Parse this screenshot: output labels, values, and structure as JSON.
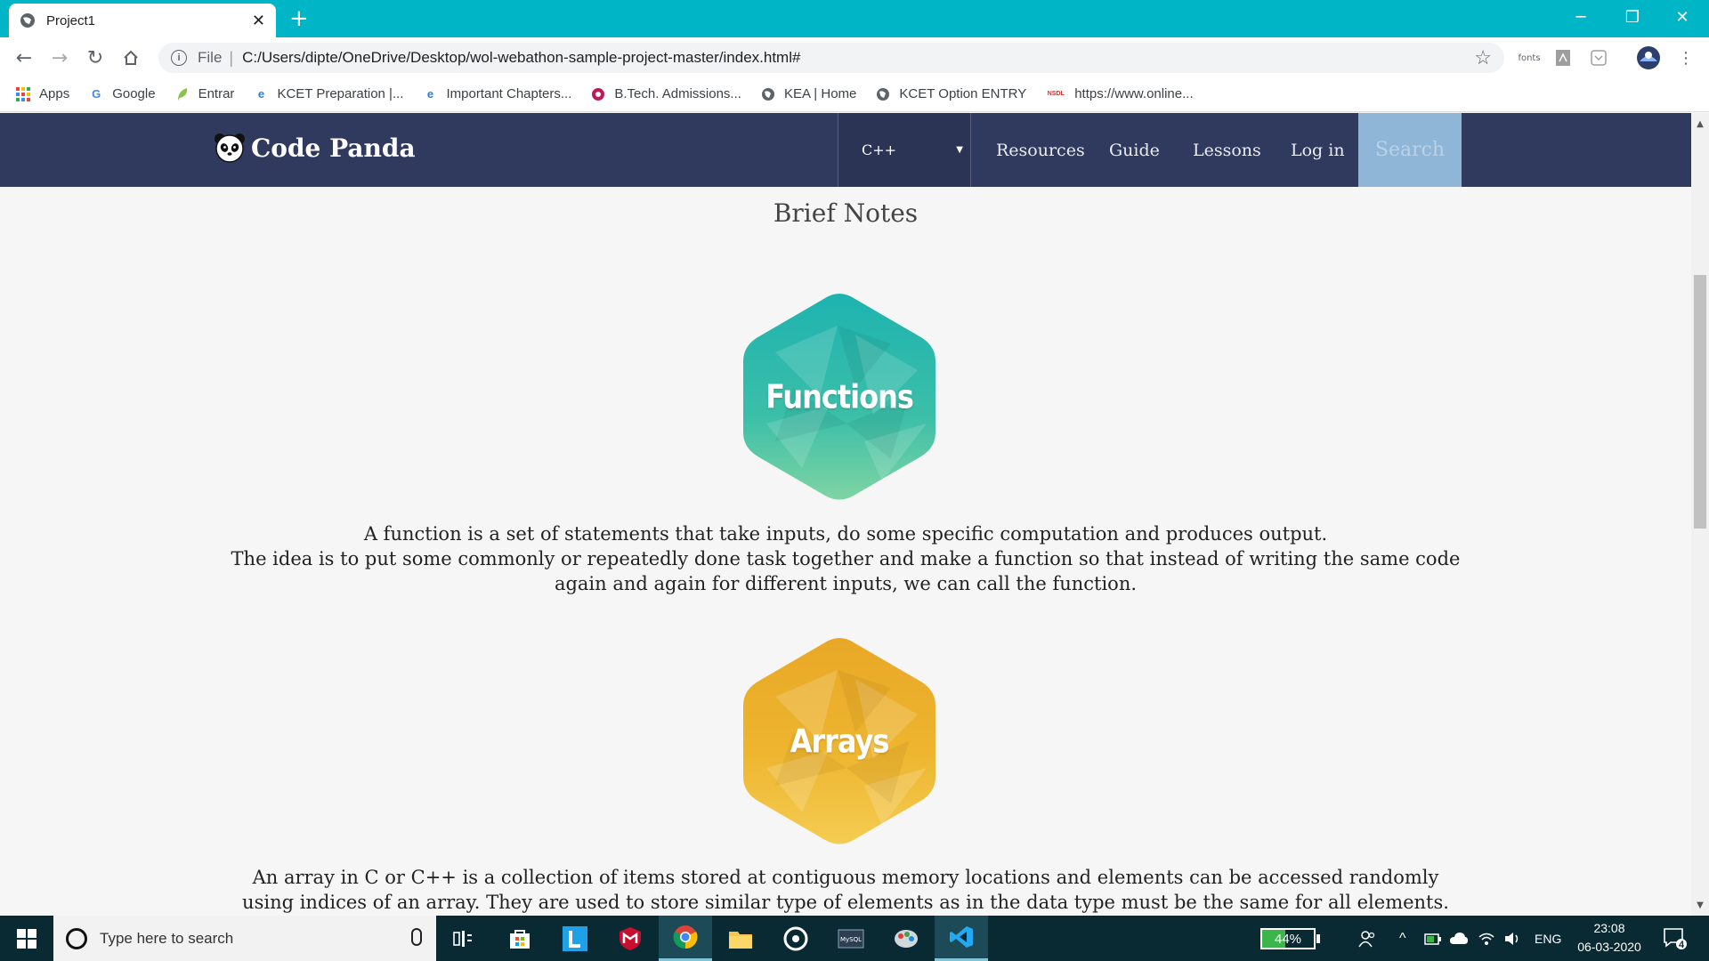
{
  "browser": {
    "tab_title": "Project1",
    "url_scheme": "File",
    "url": "C:/Users/dipte/OneDrive/Desktop/wol-webathon-sample-project-master/index.html#",
    "extension_fonts_label": "fonts",
    "bookmarks": [
      {
        "label": "Apps",
        "icon": "apps-grid-icon"
      },
      {
        "label": "Google",
        "icon": "google-icon"
      },
      {
        "label": "Entrar",
        "icon": "leaf-icon"
      },
      {
        "label": "KCET Preparation |...",
        "icon": "edge-icon"
      },
      {
        "label": "Important Chapters...",
        "icon": "edge-icon"
      },
      {
        "label": "B.Tech. Admissions...",
        "icon": "college-icon"
      },
      {
        "label": "KEA | Home",
        "icon": "globe-icon"
      },
      {
        "label": "KCET Option ENTRY",
        "icon": "globe-icon"
      },
      {
        "label": "https://www.online...",
        "icon": "nsdl-icon"
      }
    ],
    "bookmark_nsdl_text": "NSDL"
  },
  "site": {
    "brand": "Code Panda",
    "language_select": "C++",
    "nav_links": [
      "Resources",
      "Guide",
      "Lessons",
      "Log in"
    ],
    "search_label": "Search",
    "nav_bg": "#303a5e"
  },
  "content": {
    "section_title": "Brief Notes",
    "topics": [
      {
        "label": "Functions",
        "color": "#2bb8a9",
        "lines": [
          "A function is a set of statements that take inputs, do some specific computation and produces output.",
          "The idea is to put some commonly or repeatedly done task together and make a function so that instead of writing the same code again and again for different inputs, we can call the function."
        ]
      },
      {
        "label": "Arrays",
        "color": "#ecb32c",
        "lines": [
          "An array in C or C++ is a collection of items stored at contiguous memory locations and elements can be accessed randomly using indices of an array. They are used to store similar type of elements as in the data type must be the same for all elements. They can be"
        ]
      }
    ]
  },
  "taskbar": {
    "search_placeholder": "Type here to search",
    "battery_percent": "44%",
    "battery_level": 0.44,
    "language": "ENG",
    "time": "23:08",
    "date": "06-03-2020",
    "notification_count": "4",
    "mysql_label": "MySQL"
  }
}
